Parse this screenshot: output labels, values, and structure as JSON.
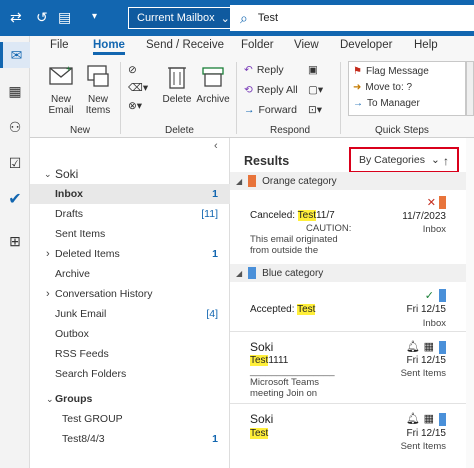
{
  "titlebar": {
    "mailbox_label": "Current Mailbox",
    "search_value": "Test"
  },
  "tabs": [
    "File",
    "Home",
    "Send / Receive",
    "Folder",
    "View",
    "Developer",
    "Help"
  ],
  "ribbon": {
    "new_email": "New\nEmail",
    "new_items": "New\nItems",
    "delete": "Delete",
    "archive": "Archive",
    "reply": "Reply",
    "reply_all": "Reply All",
    "forward": "Forward",
    "flag_message": "Flag Message",
    "move_to": "Move to: ?",
    "to_manager": "To Manager",
    "groups": {
      "new": "New",
      "delete": "Delete",
      "respond": "Respond",
      "quick_steps": "Quick Steps"
    }
  },
  "folders": {
    "account": "Soki",
    "items": [
      {
        "name": "Inbox",
        "count": "1",
        "selected": true
      },
      {
        "name": "Drafts",
        "count": "[11]"
      },
      {
        "name": "Sent Items",
        "count": ""
      },
      {
        "name": "Deleted Items",
        "count": "1",
        "expandable": true
      },
      {
        "name": "Archive",
        "count": ""
      },
      {
        "name": "Conversation History",
        "count": "",
        "expandable": true
      },
      {
        "name": "Junk Email",
        "count": "[4]"
      },
      {
        "name": "Outbox",
        "count": ""
      },
      {
        "name": "RSS Feeds",
        "count": ""
      },
      {
        "name": "Search Folders",
        "count": ""
      }
    ],
    "groups_label": "Groups",
    "groups": [
      {
        "name": "Test GROUP",
        "count": ""
      },
      {
        "name": "Test8/4/3",
        "count": "1"
      }
    ]
  },
  "results": {
    "title": "Results",
    "sort_label": "By Categories",
    "categories": [
      {
        "name": "Orange category",
        "color": "#e8743b"
      },
      {
        "name": "Blue category",
        "color": "#4a90d9"
      }
    ],
    "mails": [
      {
        "subject_pre": "Canceled: ",
        "subject_hl": "Test",
        "subject_post": "11/7",
        "date": "11/7/2023",
        "preview": "CAUTION:",
        "preview2": "This email originated",
        "preview3": "from outside the",
        "folder": "Inbox"
      },
      {
        "subject_pre": "Accepted: ",
        "subject_hl": "Test",
        "subject_post": "",
        "date": "Fri 12/15",
        "folder": "Inbox"
      },
      {
        "from": "Soki",
        "subject_hl": "Test",
        "subject_post": "1111",
        "date": "Fri 12/15",
        "folder": "Sent Items",
        "preview": "________________",
        "preview2": "Microsoft Teams",
        "preview3": "meeting  Join on"
      },
      {
        "from": "Soki",
        "subject_hl": "Test",
        "subject_post": "",
        "date": "Fri 12/15",
        "folder": "Sent Items"
      }
    ]
  }
}
